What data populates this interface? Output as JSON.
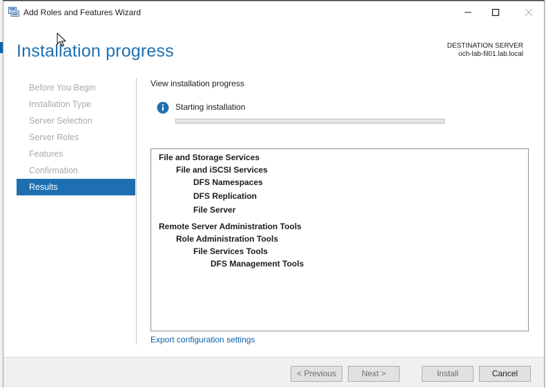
{
  "window": {
    "title": "Add Roles and Features Wizard",
    "icons": {
      "app": "server-manager-icon",
      "minimize": "minimize-icon",
      "maximize": "maximize-icon",
      "close": "close-icon"
    }
  },
  "header": {
    "page_title": "Installation progress",
    "destination_label": "DESTINATION SERVER",
    "destination_server": "och-lab-fil01.lab.local"
  },
  "nav": {
    "items": [
      {
        "label": "Before You Begin",
        "active": false
      },
      {
        "label": "Installation Type",
        "active": false
      },
      {
        "label": "Server Selection",
        "active": false
      },
      {
        "label": "Server Roles",
        "active": false
      },
      {
        "label": "Features",
        "active": false
      },
      {
        "label": "Confirmation",
        "active": false
      },
      {
        "label": "Results",
        "active": true
      }
    ]
  },
  "main": {
    "view_label": "View installation progress",
    "status_icon": "info-icon",
    "status_text": "Starting installation",
    "progress": 0,
    "features": [
      {
        "label": "File and Storage Services",
        "level": 0
      },
      {
        "label": "File and iSCSI Services",
        "level": 1
      },
      {
        "label": "DFS Namespaces",
        "level": 2
      },
      {
        "label": "DFS Replication",
        "level": 2
      },
      {
        "label": "File Server",
        "level": 2
      },
      {
        "label": "Remote Server Administration Tools",
        "level": 0
      },
      {
        "label": "Role Administration Tools",
        "level": 1
      },
      {
        "label": "File Services Tools",
        "level": 2
      },
      {
        "label": "DFS Management Tools",
        "level": 3
      }
    ],
    "export_link": "Export configuration settings"
  },
  "footer": {
    "previous": "< Previous",
    "next": "Next >",
    "install": "Install",
    "cancel": "Cancel"
  },
  "colors": {
    "accent": "#1e6fb2",
    "title": "#1f6fb0",
    "link": "#0d5ea8",
    "nav_disabled": "#a9a9a9"
  }
}
